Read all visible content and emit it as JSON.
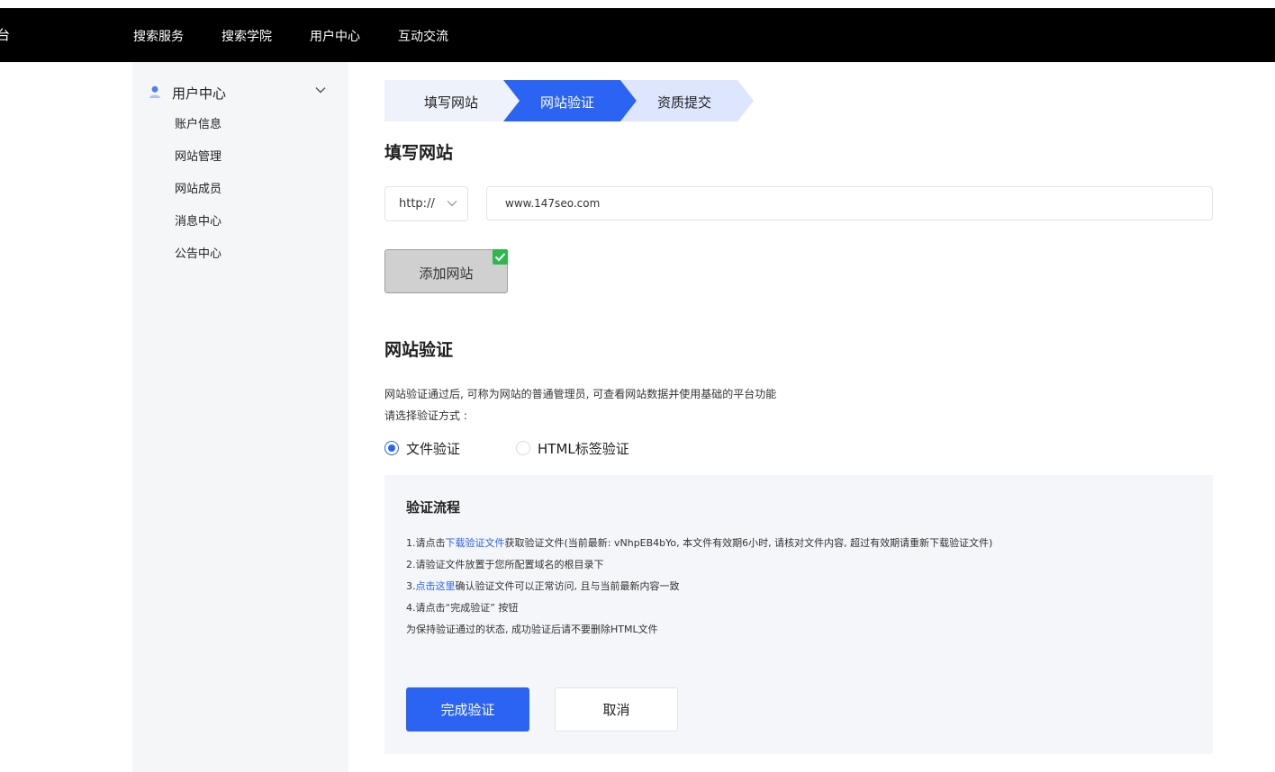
{
  "header": {
    "brand": "台",
    "nav": [
      "搜索服务",
      "搜索学院",
      "用户中心",
      "互动交流"
    ]
  },
  "sidebar": {
    "title": "用户中心",
    "items": [
      "账户信息",
      "网站管理",
      "网站成员",
      "消息中心",
      "公告中心"
    ]
  },
  "steps": [
    "填写网站",
    "网站验证",
    "资质提交"
  ],
  "fill_site": {
    "heading": "填写网站",
    "protocol": "http://",
    "url": "www.147seo.com",
    "add_button": "添加网站"
  },
  "verify": {
    "heading": "网站验证",
    "desc1": "网站验证通过后, 可称为网站的普通管理员, 可查看网站数据并使用基础的平台功能",
    "desc2": "请选择验证方式 :",
    "methods": [
      "文件验证",
      "HTML标签验证"
    ],
    "selected_method": "文件验证",
    "process": {
      "title": "验证流程",
      "line1_pre": "1.请点击",
      "line1_link": "下载验证文件",
      "line1_post": "获取验证文件(当前最新: vNhpEB4bYo, 本文件有效期6小时, 请核对文件内容, 超过有效期请重新下载验证文件)",
      "line2": "2.请验证文件放置于您所配置域名的根目录下",
      "line3_pre": "3.",
      "line3_link": "点击这里",
      "line3_post": "确认验证文件可以正常访问, 且与当前最新内容一致",
      "line4": "4.请点击“完成验证” 按钮",
      "line5": "为保持验证通过的状态, 成功验证后请不要删除HTML文件"
    },
    "confirm_button": "完成验证",
    "cancel_button": "取消"
  },
  "colors": {
    "primary": "#2b63f2",
    "step_inactive": "#dde6fd",
    "step_first": "#eef2fb",
    "topbar": "#000000",
    "sidebar": "#f5f6f8",
    "success": "#2db84d"
  }
}
